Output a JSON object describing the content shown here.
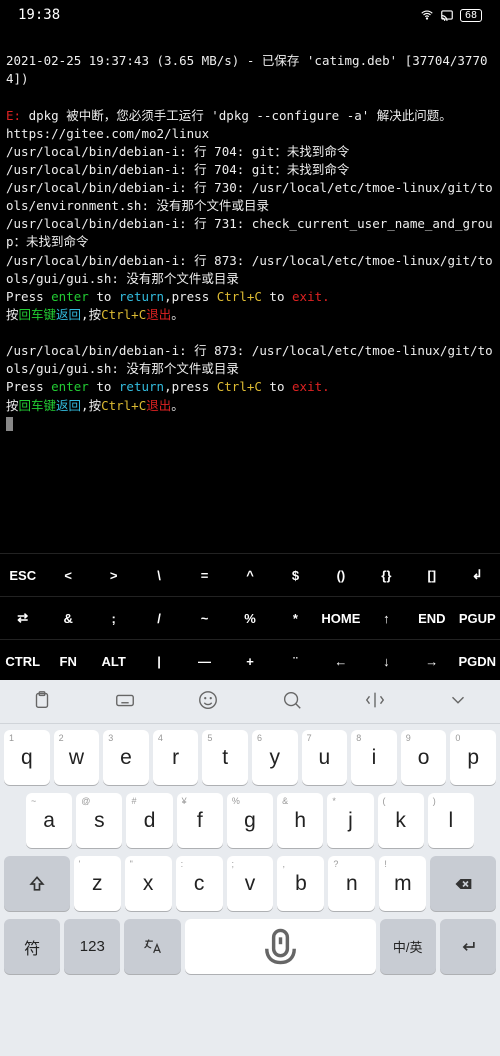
{
  "status": {
    "time": "19:38",
    "battery": "68"
  },
  "term": {
    "l1": "2021-02-25 19:37:43 (3.65 MB/s) - 已保存 'catimg.deb' [37704/37704])",
    "errPrefix": "E:",
    "errMsg": " dpkg 被中断，您必须手工运行 'dpkg --configure -a' 解决此问题。",
    "l3": "https://gitee.com/mo2/linux",
    "l4": "/usr/local/bin/debian-i: 行 704: git：未找到命令",
    "l5": "/usr/local/bin/debian-i: 行 704: git：未找到命令",
    "l6": "/usr/local/bin/debian-i: 行 730: /usr/local/etc/tmoe-linux/git/tools/environment.sh: 没有那个文件或目录",
    "l7": "/usr/local/bin/debian-i: 行 731: check_current_user_name_and_group：未找到命令",
    "l8": "/usr/local/bin/debian-i: 行 873: /usr/local/etc/tmoe-linux/git/tools/gui/gui.sh: 没有那个文件或目录",
    "prA": "Press ",
    "prEnter": "enter",
    "prB": " to ",
    "prReturn": "return",
    "prC": ",press ",
    "prCtrlC": "Ctrl+C",
    "prD": " to ",
    "prExit": "exit.",
    "cnA": "按",
    "cnEnter": "回车键",
    "cnReturn": "返回",
    "cnB": ",按",
    "cnCtrlC": "Ctrl+C",
    "cnExit": "退出",
    "cnC": "。"
  },
  "skeys": {
    "r1": [
      "ESC",
      "<",
      ">",
      "\\",
      "=",
      "^",
      "$",
      "()",
      "{}",
      "[]",
      "↲"
    ],
    "r2": [
      "⇄",
      "&",
      ";",
      "/",
      "~",
      "%",
      "*",
      "HOME",
      "↑",
      "END",
      "PGUP"
    ],
    "r3": [
      "CTRL",
      "FN",
      "ALT",
      "|",
      "—",
      "+",
      "¨",
      "←",
      "↓",
      "→",
      "PGDN"
    ]
  },
  "kb": {
    "r1": [
      {
        "s": "1",
        "m": "q"
      },
      {
        "s": "2",
        "m": "w"
      },
      {
        "s": "3",
        "m": "e"
      },
      {
        "s": "4",
        "m": "r"
      },
      {
        "s": "5",
        "m": "t"
      },
      {
        "s": "6",
        "m": "y"
      },
      {
        "s": "7",
        "m": "u"
      },
      {
        "s": "8",
        "m": "i"
      },
      {
        "s": "9",
        "m": "o"
      },
      {
        "s": "0",
        "m": "p"
      }
    ],
    "r2": [
      {
        "s": "~",
        "m": "a"
      },
      {
        "s": "@",
        "m": "s"
      },
      {
        "s": "#",
        "m": "d"
      },
      {
        "s": "¥",
        "m": "f"
      },
      {
        "s": "%",
        "m": "g"
      },
      {
        "s": "&",
        "m": "h"
      },
      {
        "s": "*",
        "m": "j"
      },
      {
        "s": "(",
        "m": "k"
      },
      {
        "s": ")",
        "m": "l"
      }
    ],
    "r3": [
      {
        "s": "'",
        "m": "z"
      },
      {
        "s": "\"",
        "m": "x"
      },
      {
        "s": ":",
        "m": "c"
      },
      {
        "s": ";",
        "m": "v"
      },
      {
        "s": ",",
        "m": "b"
      },
      {
        "s": "?",
        "m": "n"
      },
      {
        "s": "!",
        "m": "m"
      }
    ],
    "bottom": {
      "sym": "符",
      "num": "123",
      "lang": "中/英"
    }
  }
}
